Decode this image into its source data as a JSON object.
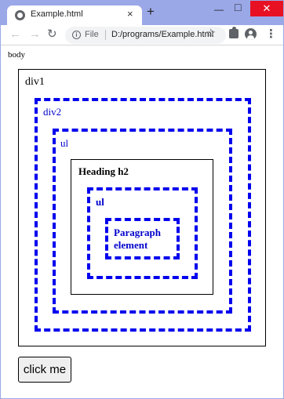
{
  "browser": {
    "tab_title": "Example.html",
    "tab_close": "×",
    "new_tab": "+",
    "minimize": "—",
    "maximize": "□",
    "close": "✕",
    "back": "←",
    "forward": "→",
    "reload": "↻",
    "info": "i",
    "scheme": "File",
    "url": "D:/programs/Example.html",
    "star": "☆",
    "menu": "⋮"
  },
  "page": {
    "body_label": "body",
    "div1_label": "div1",
    "div2_label": "div2",
    "ul1_label": "ul",
    "h2_label": "Heading h2",
    "ul2_label": "ul",
    "p_label": "Paragraph element",
    "button_label": "click me"
  },
  "colors": {
    "dashed_border": "#0000ee",
    "label_blue": "#0000cc",
    "window_frame": "#9aa8e8"
  }
}
